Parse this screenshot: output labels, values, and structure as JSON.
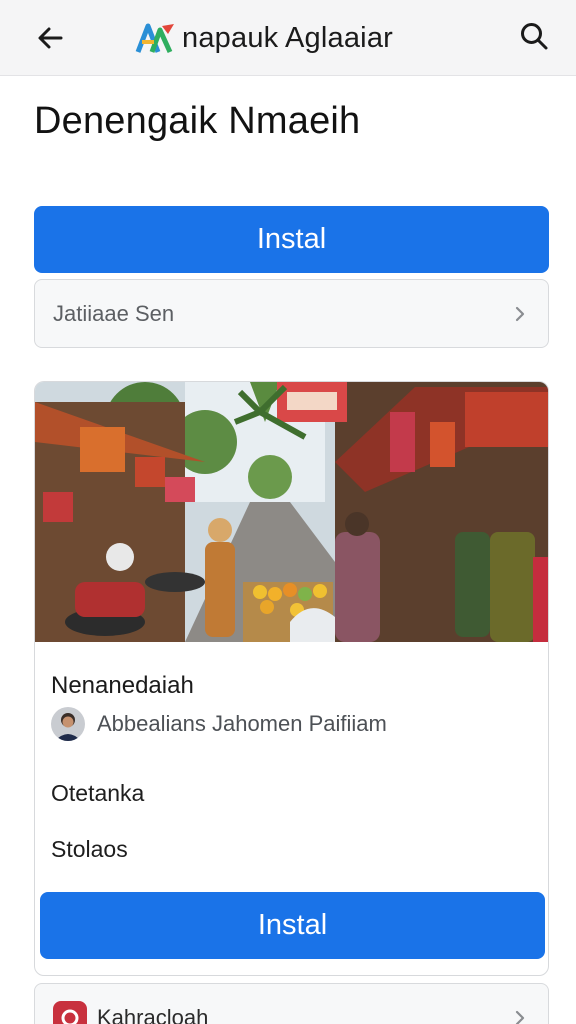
{
  "topbar": {
    "back_icon": "arrow-left-icon",
    "app_title": "napauk Aglaaiar",
    "search_icon": "search-icon"
  },
  "page": {
    "title": "Denengaik Nmaeih"
  },
  "primary_button": {
    "label": "Instal"
  },
  "language_row": {
    "label": "Jatiiaae Sen",
    "chevron_icon": "chevron-right-icon"
  },
  "card": {
    "image_icon": "market-street-photo",
    "title": "Nenanedaiah",
    "author": "Abbealians Jahomen Paifiiam",
    "meta1": "Otetanka",
    "meta2": "Stolaos",
    "button_label": "Instal"
  },
  "bottom_row": {
    "label": "Kahracloah",
    "icon": "app-icon",
    "chevron_icon": "chevron-right-icon"
  },
  "colors": {
    "accent": "#1a73e8",
    "background": "#ffffff",
    "topbar": "#f5f5f6"
  }
}
